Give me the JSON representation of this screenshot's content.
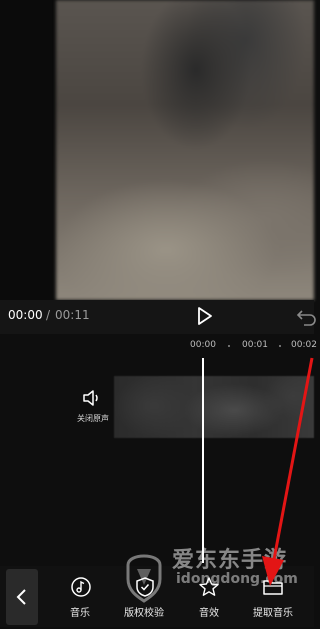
{
  "playback": {
    "current_time": "00:00",
    "separator": "/",
    "total_time": "00:11"
  },
  "timeline": {
    "ruler_labels": [
      "00:00",
      "00:01",
      "00:02"
    ],
    "mute_label": "关闭原声"
  },
  "toolbar": {
    "items": [
      {
        "label": "音乐",
        "icon": "music-note-icon"
      },
      {
        "label": "版权校验",
        "icon": "shield-check-icon"
      },
      {
        "label": "音效",
        "icon": "star-icon"
      },
      {
        "label": "提取音乐",
        "icon": "folder-icon"
      }
    ]
  },
  "watermark": {
    "title": "爱东东手游",
    "url": "idongdong.com"
  },
  "colors": {
    "annotation_arrow": "#e31515",
    "playhead": "#ffffff",
    "background": "#0e0e0e"
  }
}
